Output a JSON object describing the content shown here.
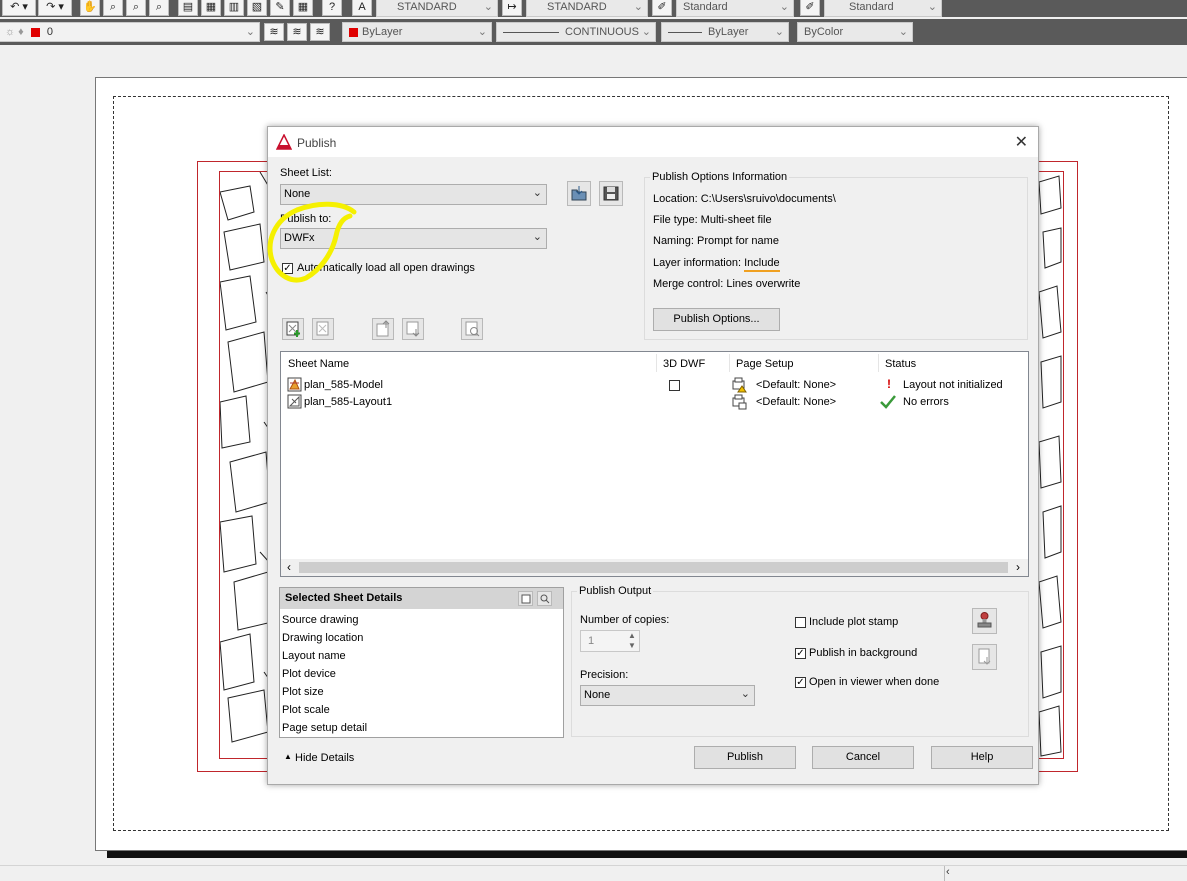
{
  "toolbar_top": {
    "text_style": "STANDARD",
    "dim_style": "STANDARD",
    "table_style": "Standard",
    "mleader_style": "Standard"
  },
  "toolbar_layers": {
    "layer": "0",
    "color": "ByLayer",
    "linetype": "CONTINUOUS",
    "lineweight": "ByLayer",
    "plotstyle": "ByColor",
    "layer_color_hex": "#e00000"
  },
  "dialog": {
    "title": "Publish",
    "close": "✕",
    "sheet_list_label": "Sheet List:",
    "sheet_list_value": "None",
    "publish_to_label": "Publish to:",
    "publish_to_value": "DWFx",
    "auto_load_label": "Automatically load all open drawings",
    "auto_load_checked": true,
    "options_info": {
      "header": "Publish Options Information",
      "location": "Location: C:\\Users\\sruivo\\documents\\",
      "file_type": "File type: Multi-sheet file",
      "naming": "Naming: Prompt for name",
      "layer_info_label": "Layer information: ",
      "layer_info_value": "Include",
      "merge_control": "Merge control: Lines overwrite",
      "button": "Publish Options..."
    },
    "table": {
      "headers": [
        "Sheet Name",
        "3D DWF",
        "Page Setup",
        "Status"
      ],
      "rows": [
        {
          "name": "plan_585-Model",
          "page_setup": "<Default: None>",
          "status": "Layout not initialized",
          "has_3d_checkbox": true
        },
        {
          "name": "plan_585-Layout1",
          "page_setup": "<Default: None>",
          "status": "No errors",
          "has_3d_checkbox": false
        }
      ]
    },
    "details": {
      "header": "Selected Sheet Details",
      "items": [
        "Source drawing",
        "Drawing location",
        "Layout name",
        "Plot device",
        "Plot size",
        "Plot scale",
        "Page setup detail"
      ]
    },
    "output": {
      "header": "Publish Output",
      "copies_label": "Number of copies:",
      "copies_value": "1",
      "precision_label": "Precision:",
      "precision_value": "None",
      "include_plot_stamp": "Include plot stamp",
      "include_plot_stamp_checked": false,
      "publish_background": "Publish in background",
      "publish_background_checked": true,
      "open_viewer": "Open in viewer when done",
      "open_viewer_checked": true
    },
    "hide_details": "Hide Details",
    "buttons": {
      "publish": "Publish",
      "cancel": "Cancel",
      "help": "Help"
    }
  },
  "colors": {
    "highlight_yellow": "#f5f000",
    "underline_orange": "#f0a020",
    "frame_red": "#c0262c",
    "status_error": "#d40000",
    "status_ok": "#3a9a3a"
  }
}
